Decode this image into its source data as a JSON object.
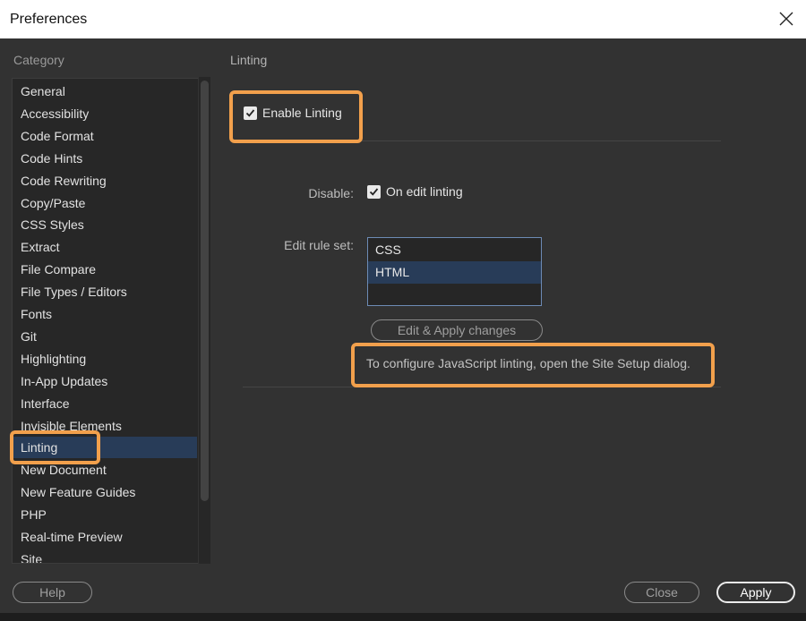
{
  "window": {
    "title": "Preferences",
    "close_icon": "close-icon"
  },
  "sidebar": {
    "heading": "Category",
    "selected_item": "Linting",
    "items": [
      "General",
      "Accessibility",
      "Code Format",
      "Code Hints",
      "Code Rewriting",
      "Copy/Paste",
      "CSS Styles",
      "Extract",
      "File Compare",
      "File Types / Editors",
      "Fonts",
      "Git",
      "Highlighting",
      "In-App Updates",
      "Interface",
      "Invisible Elements",
      "Linting",
      "New Document",
      "New Feature Guides",
      "PHP",
      "Real-time Preview",
      "Site"
    ]
  },
  "panel": {
    "title": "Linting",
    "enable_linting": {
      "label": "Enable Linting",
      "checked": true
    },
    "disable_label": "Disable:",
    "on_edit_linting": {
      "label": "On edit linting",
      "checked": true
    },
    "rule_set_label": "Edit rule set:",
    "rule_sets": [
      "CSS",
      "HTML"
    ],
    "selected_rule_set": "HTML",
    "edit_apply_label": "Edit  & Apply changes",
    "info_text": "To configure JavaScript linting, open the Site Setup dialog."
  },
  "footer": {
    "help_label": "Help",
    "close_label": "Close",
    "apply_label": "Apply"
  },
  "colors": {
    "highlight": "#f2a04c",
    "selection": "#283c58",
    "dialog_bg": "#323232"
  }
}
